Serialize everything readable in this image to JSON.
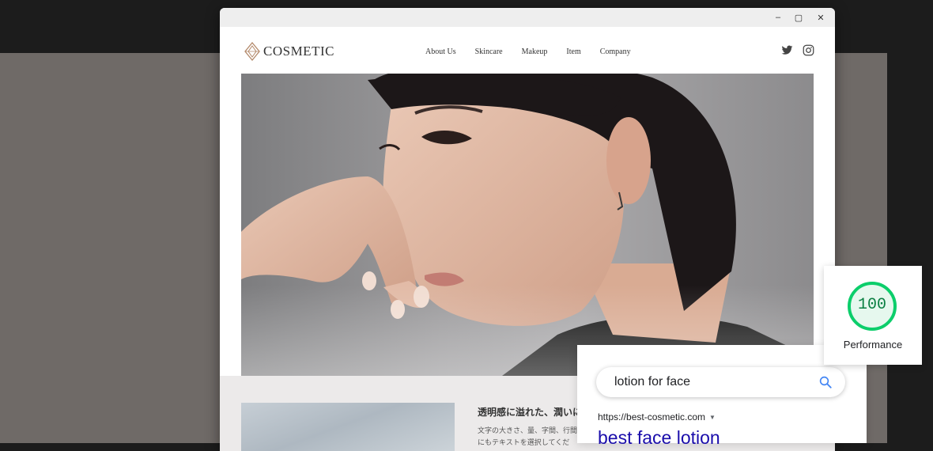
{
  "window": {
    "controls": {
      "minimize": "–",
      "maximize": "▢",
      "close": "✕"
    }
  },
  "site": {
    "brand": "COSMETIC",
    "nav": [
      "About Us",
      "Skincare",
      "Makeup",
      "Item",
      "Company"
    ],
    "social_icons": [
      "twitter-icon",
      "instagram-icon"
    ]
  },
  "hero": {
    "image": "portrait of a woman with short dark hair, hand near chin, on grey background"
  },
  "content": {
    "heading": "透明感に溢れた、潤いに",
    "body_lines": [
      "文字の大きさ、量、字間、行間",
      "にもテキストを選択してくだ"
    ]
  },
  "search": {
    "query": "lotion for face",
    "result_url": "https://best-cosmetic.com",
    "result_title": "best face lotion"
  },
  "performance": {
    "score": "100",
    "score_fraction": 1.0,
    "label": "Performance",
    "color": "#0cce6b"
  }
}
